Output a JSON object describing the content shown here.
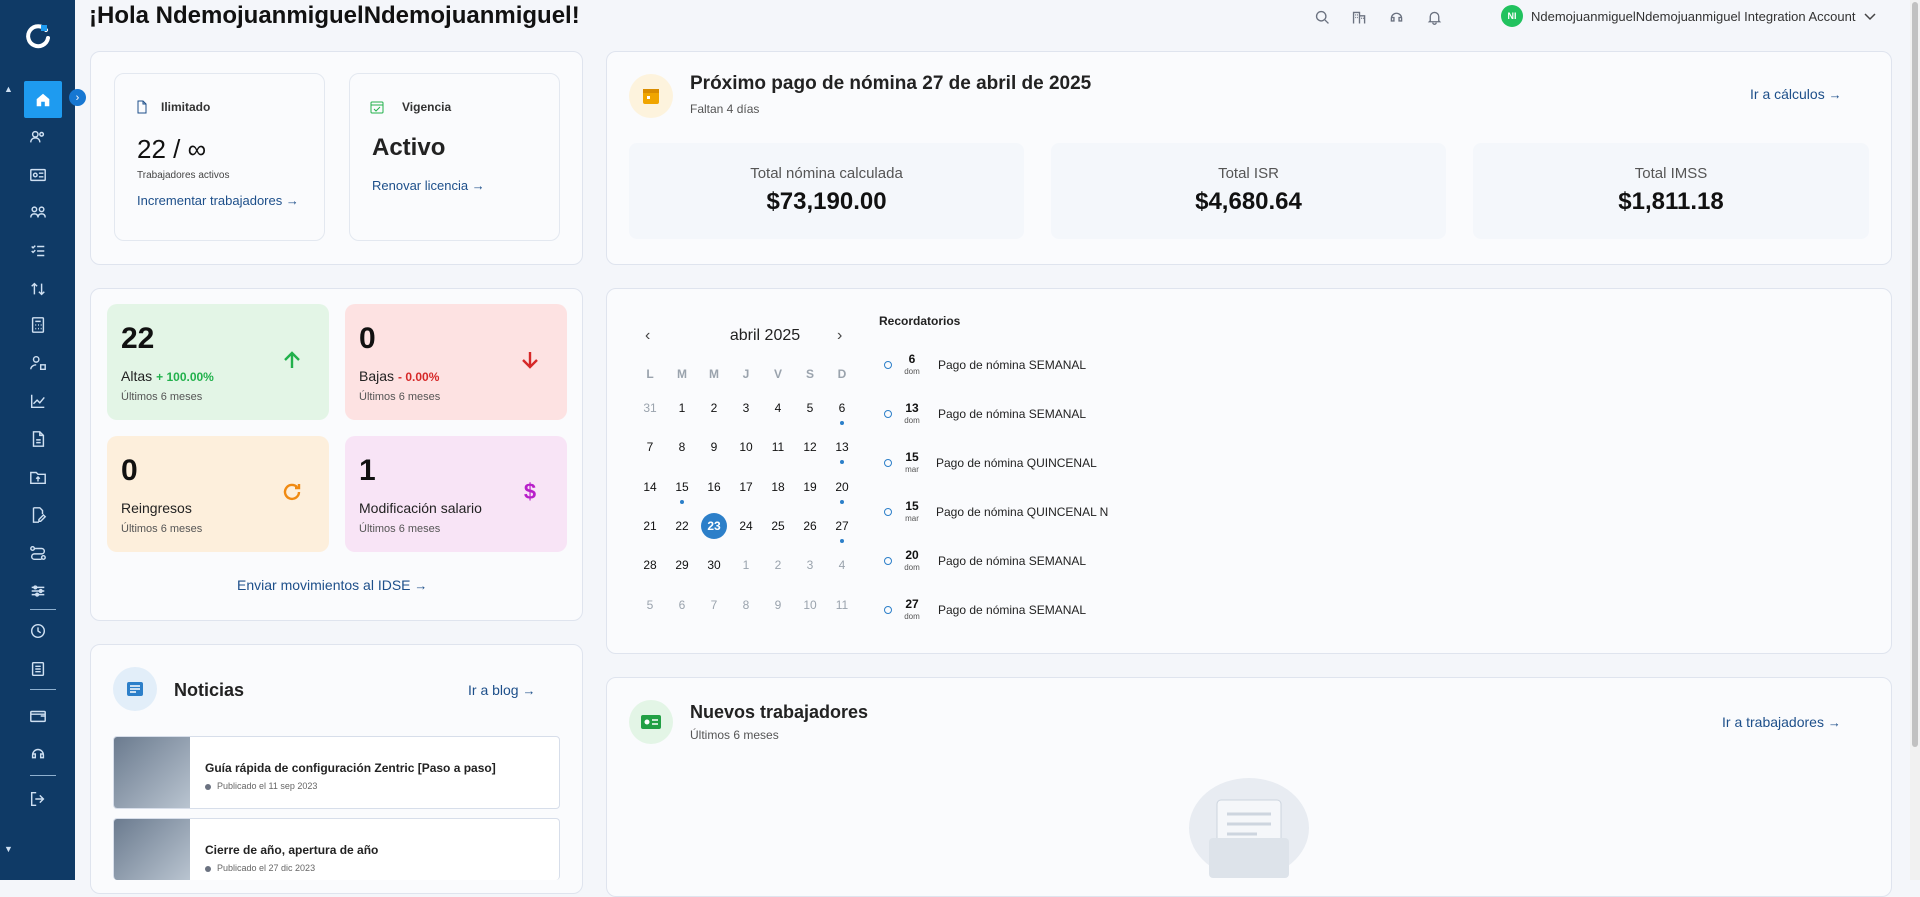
{
  "header": {
    "greeting": "¡Hola NdemojuanmiguelNdemojuanmiguel!",
    "account_initials": "NI",
    "account_name": "NdemojuanmiguelNdemojuanmiguel Integration Account"
  },
  "license": {
    "plan_label": "Ilimitado",
    "workers_value": "22 / ∞",
    "workers_caption": "Trabajadores activos",
    "increase_link": "Incrementar trabajadores",
    "validity_label": "Vigencia",
    "validity_value": "Activo",
    "renew_link": "Renovar licencia"
  },
  "payroll": {
    "title": "Próximo pago de nómina 27 de abril de 2025",
    "subtitle": "Faltan 4 días",
    "link": "Ir a cálculos",
    "totals": [
      {
        "label": "Total nómina calculada",
        "value": "$73,190.00"
      },
      {
        "label": "Total ISR",
        "value": "$4,680.64"
      },
      {
        "label": "Total IMSS",
        "value": "$1,811.18"
      }
    ]
  },
  "movements": {
    "altas": {
      "value": "22",
      "label": "Altas",
      "pct": "+ 100.00%",
      "period": "Últimos 6 meses",
      "color": "#22b14c"
    },
    "bajas": {
      "value": "0",
      "label": "Bajas",
      "pct": "- 0.00%",
      "period": "Últimos 6 meses",
      "color": "#d62828"
    },
    "reingresos": {
      "value": "0",
      "label": "Reingresos",
      "period": "Últimos 6 meses",
      "color": "#f08a12"
    },
    "salario": {
      "value": "1",
      "label": "Modificación salario",
      "period": "Últimos 6 meses",
      "color": "#b81fc9"
    },
    "idse_link": "Enviar movimientos al IDSE"
  },
  "calendar": {
    "month": "abril 2025",
    "weekdays": [
      "L",
      "M",
      "M",
      "J",
      "V",
      "S",
      "D"
    ],
    "weeks": [
      [
        "31",
        "1",
        "2",
        "3",
        "4",
        "5",
        "6"
      ],
      [
        "7",
        "8",
        "9",
        "10",
        "11",
        "12",
        "13"
      ],
      [
        "14",
        "15",
        "16",
        "17",
        "18",
        "19",
        "20"
      ],
      [
        "21",
        "22",
        "23",
        "24",
        "25",
        "26",
        "27"
      ],
      [
        "28",
        "29",
        "30",
        "1",
        "2",
        "3",
        "4"
      ],
      [
        "5",
        "6",
        "7",
        "8",
        "9",
        "10",
        "11"
      ]
    ],
    "today": "23"
  },
  "reminders": {
    "title": "Recordatorios",
    "items": [
      {
        "day": "6",
        "weekday": "dom",
        "text": "Pago de nómina SEMANAL"
      },
      {
        "day": "13",
        "weekday": "dom",
        "text": "Pago de nómina SEMANAL"
      },
      {
        "day": "15",
        "weekday": "mar",
        "text": "Pago de nómina QUINCENAL"
      },
      {
        "day": "15",
        "weekday": "mar",
        "text": "Pago de nómina QUINCENAL N"
      },
      {
        "day": "20",
        "weekday": "dom",
        "text": "Pago de nómina SEMANAL"
      },
      {
        "day": "27",
        "weekday": "dom",
        "text": "Pago de nómina SEMANAL"
      }
    ]
  },
  "news": {
    "title": "Noticias",
    "link": "Ir a blog",
    "items": [
      {
        "title": "Guía rápida de configuración Zentric [Paso a paso]",
        "date": "Publicado el 11 sep 2023"
      },
      {
        "title": "Cierre de año, apertura de año",
        "date": "Publicado el 27 dic 2023"
      }
    ]
  },
  "new_workers": {
    "title": "Nuevos trabajadores",
    "subtitle": "Últimos 6 meses",
    "link": "Ir a trabajadores"
  },
  "colors": {
    "sidebar": "#0f3a66",
    "accent": "#1e9bf0",
    "link": "#1d4f8a"
  }
}
